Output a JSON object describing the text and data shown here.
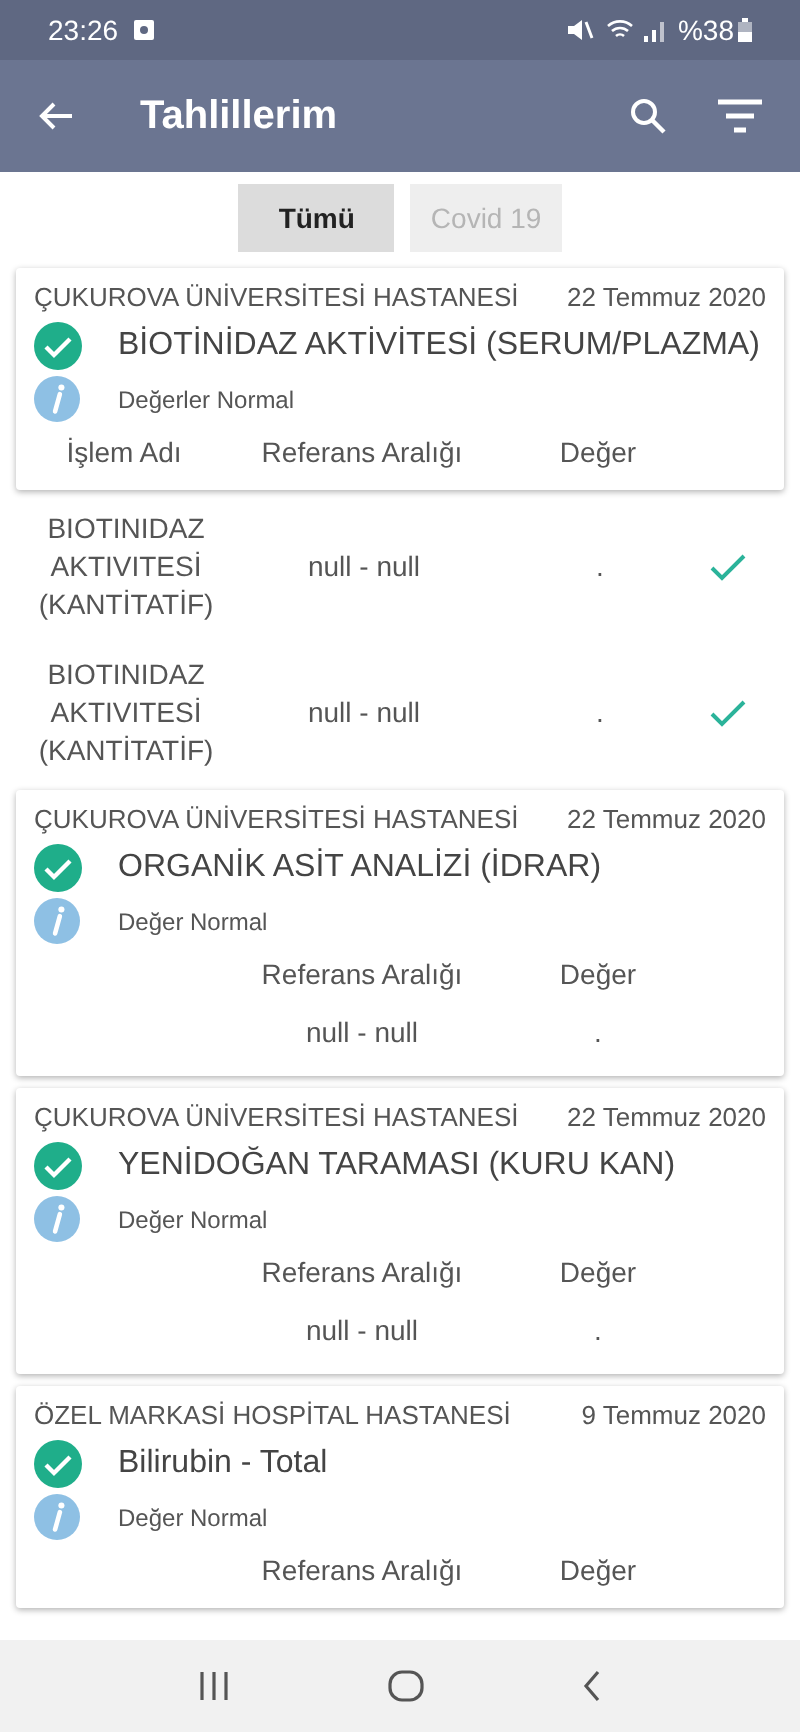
{
  "status_bar": {
    "time": "23:26",
    "battery": "%38"
  },
  "app_bar": {
    "title": "Tahlillerim"
  },
  "filters": [
    {
      "label": "Tümü",
      "selected": true
    },
    {
      "label": "Covid 19",
      "selected": false
    }
  ],
  "cards": [
    {
      "hospital": "ÇUKUROVA ÜNİVERSİTESİ HASTANESİ",
      "date": "22 Temmuz 2020",
      "title": "BİOTİNİDAZ AKTİVİTESİ (SERUM/PLAZMA)",
      "normal": true,
      "note": "Değerler Normal",
      "kind": "detailed",
      "columns": {
        "name": "İşlem Adı",
        "range": "Referans Aralığı",
        "value": "Değer"
      },
      "rows": [
        {
          "name": "BIOTINIDAZ AKTIVITESİ (KANTİTATİF)",
          "range": "null - null",
          "value": ".",
          "checked": true
        },
        {
          "name": "BIOTINIDAZ AKTIVITESİ (KANTİTATİF)",
          "range": "null - null",
          "value": ".",
          "checked": true
        }
      ]
    },
    {
      "hospital": "ÇUKUROVA ÜNİVERSİTESİ HASTANESİ",
      "date": "22 Temmuz 2020",
      "title": "ORGANİK ASİT ANALİZİ (İDRAR)",
      "normal": true,
      "note": "Değer Normal",
      "kind": "compact",
      "columns": {
        "range": "Referans Aralığı",
        "value": "Değer"
      },
      "rows": [
        {
          "range": "null - null",
          "value": "."
        }
      ]
    },
    {
      "hospital": "ÇUKUROVA ÜNİVERSİTESİ HASTANESİ",
      "date": "22 Temmuz 2020",
      "title": "YENİDOĞAN TARAMASI (KURU KAN)",
      "normal": true,
      "note": "Değer Normal",
      "kind": "compact",
      "columns": {
        "range": "Referans Aralığı",
        "value": "Değer"
      },
      "rows": [
        {
          "range": "null - null",
          "value": "."
        }
      ]
    },
    {
      "hospital": "ÖZEL MARKASİ HOSPİTAL HASTANESİ",
      "date": "9 Temmuz 2020",
      "title": "Bilirubin - Total",
      "normal": true,
      "note": "Değer Normal",
      "kind": "compact",
      "columns": {
        "range": "Referans Aralığı",
        "value": "Değer"
      }
    }
  ]
}
